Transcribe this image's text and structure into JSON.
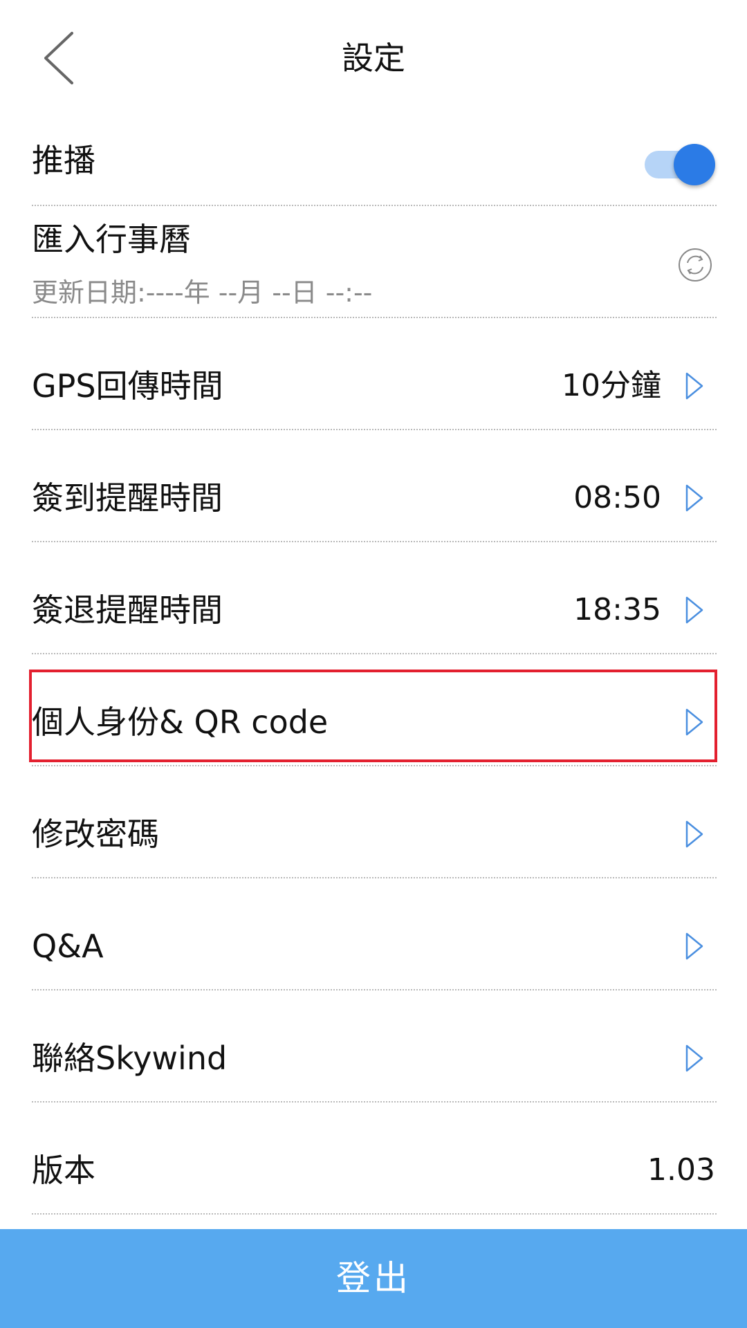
{
  "header": {
    "title": "設定"
  },
  "settings": {
    "push": {
      "label": "推播",
      "enabled": true
    },
    "calendar": {
      "label": "匯入行事曆",
      "sub": "更新日期:----年 --月 --日 --:--"
    },
    "gps": {
      "label": "GPS回傳時間",
      "value": "10分鐘"
    },
    "checkin": {
      "label": "簽到提醒時間",
      "value": "08:50"
    },
    "checkout": {
      "label": "簽退提醒時間",
      "value": "18:35"
    },
    "identity": {
      "label": "個人身份& QR code"
    },
    "password": {
      "label": "修改密碼"
    },
    "qa": {
      "label": "Q&A"
    },
    "contact": {
      "label": "聯絡Skywind"
    },
    "version": {
      "label": "版本",
      "value": "1.03"
    }
  },
  "footer": {
    "logout_label": "登出"
  },
  "colors": {
    "accent": "#2b7be6",
    "toggle_track": "#b6d4f7",
    "logout_bg": "#57a9ef",
    "highlight": "#e3202f",
    "chevron": "#4a8fe0"
  },
  "icons": {
    "back": "back-arrow-icon",
    "chevron": "chevron-right-icon",
    "sync": "sync-icon"
  }
}
